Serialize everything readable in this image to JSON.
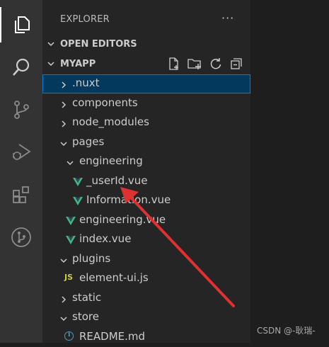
{
  "sidebar": {
    "header": "EXPLORER",
    "more": "···",
    "open_editors": "OPEN EDITORS",
    "project": "MYAPP"
  },
  "tree": {
    "nuxt": ".nuxt",
    "components": "components",
    "node_modules": "node_modules",
    "pages": "pages",
    "engineering_dir": "engineering",
    "userid": "_userId.vue",
    "information": "Information.vue",
    "engineering_vue": "engineering.vue",
    "index": "index.vue",
    "plugins": "plugins",
    "element_ui": "element-ui.js",
    "static": "static",
    "store": "store",
    "readme": "README.md"
  },
  "icons": {
    "js_badge": "JS",
    "info_glyph": "i"
  },
  "colors": {
    "vue_green": "#41b883",
    "arrow_red": "#e03030",
    "selection": "#04395e"
  },
  "watermark": "CSDN @-耿瑞-"
}
